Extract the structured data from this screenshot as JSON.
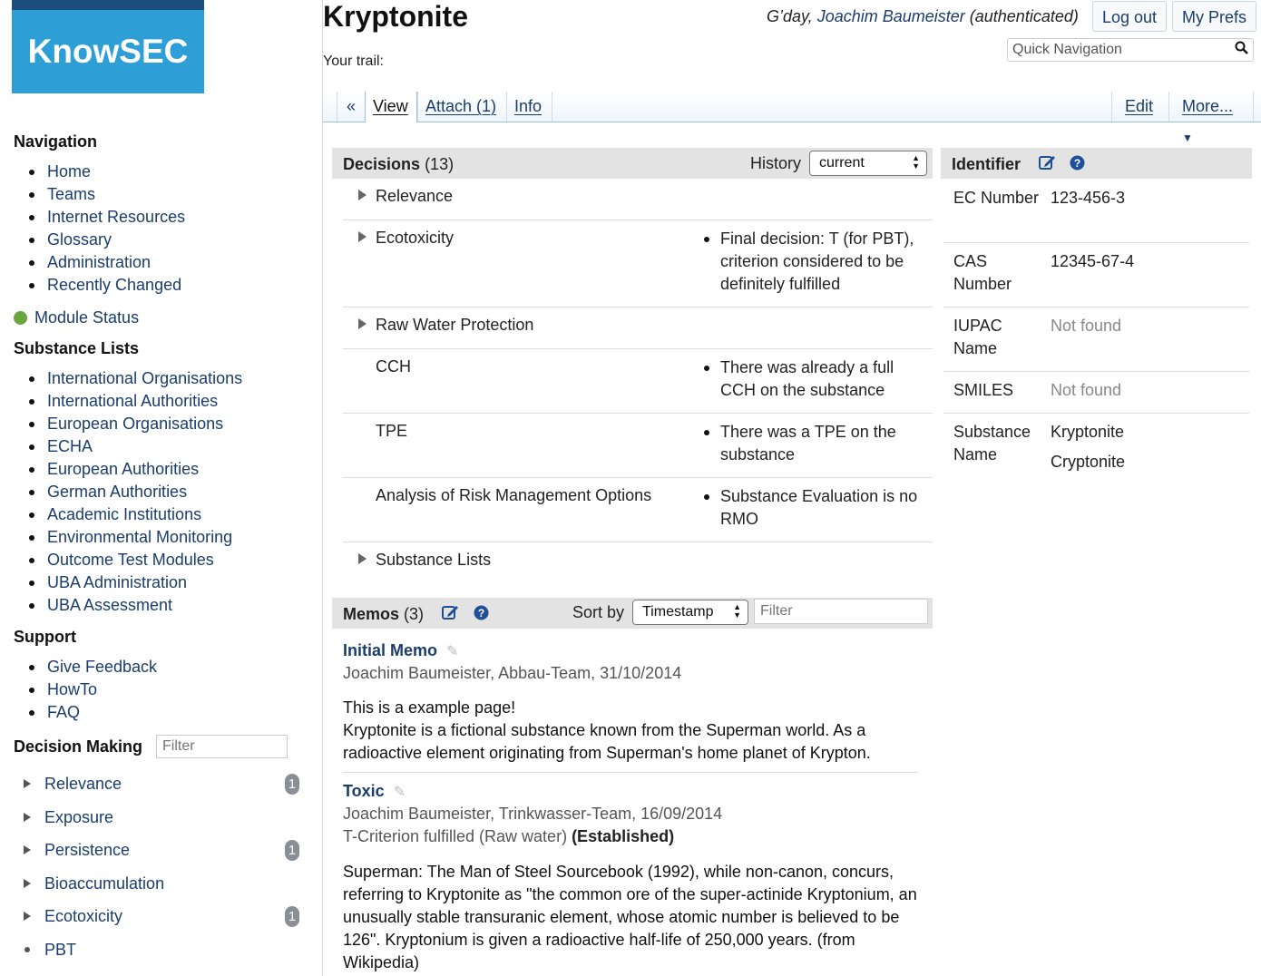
{
  "logo": {
    "text": "KnowSEC"
  },
  "page": {
    "title": "Kryptonite",
    "trail_label": "Your trail:"
  },
  "user": {
    "greeting_prefix": "G’day, ",
    "name": "Joachim Baumeister",
    "status": " (authenticated)"
  },
  "header_buttons": {
    "logout": "Log out",
    "prefs": "My Prefs"
  },
  "quick_nav": {
    "placeholder": "Quick Navigation"
  },
  "tabs": {
    "collapse": "«",
    "view": "View",
    "attach": "Attach (1)",
    "info": "Info",
    "edit": "Edit",
    "more": "More..."
  },
  "sidebar": {
    "navigation_title": "Navigation",
    "navigation": [
      "Home",
      "Teams",
      "Internet Resources",
      "Glossary",
      "Administration",
      "Recently Changed"
    ],
    "module_status": "Module Status",
    "substance_lists_title": "Substance Lists",
    "substance_lists": [
      "International Organisations",
      "International Authorities",
      "European Organisations",
      "ECHA",
      "European Authorities",
      "German Authorities",
      "Academic Institutions",
      "Environmental Monitoring",
      "Outcome Test Modules",
      "UBA Administration",
      "UBA Assessment"
    ],
    "support_title": "Support",
    "support": [
      "Give Feedback",
      "HowTo",
      "FAQ"
    ],
    "decision_making_title": "Decision Making",
    "filter_placeholder": "Filter",
    "decision_making": [
      {
        "label": "Relevance",
        "badge": "1"
      },
      {
        "label": "Exposure",
        "badge": ""
      },
      {
        "label": "Persistence",
        "badge": "1"
      },
      {
        "label": "Bioaccumulation",
        "badge": ""
      },
      {
        "label": "Ecotoxicity",
        "badge": "1"
      },
      {
        "label": "PBT",
        "badge": ""
      }
    ]
  },
  "decisions": {
    "title": "Decisions",
    "count": "(13)",
    "history_label": "History",
    "history_value": "current",
    "rows": [
      {
        "label": "Relevance",
        "note": ""
      },
      {
        "label": "Ecotoxicity",
        "note": "Final decision: T (for PBT), criterion considered to be definitely fulfilled"
      },
      {
        "label": "Raw Water Protection",
        "note": ""
      },
      {
        "label": "CCH",
        "note": "There was already a full CCH on the substance"
      },
      {
        "label": "TPE",
        "note": "There was a TPE on the substance"
      },
      {
        "label": "Analysis of Risk Management Options",
        "note": "Substance Evaluation is no RMO"
      },
      {
        "label": "Substance Lists",
        "note": ""
      }
    ]
  },
  "identifier": {
    "title": "Identifier",
    "rows": [
      {
        "key": "EC Number",
        "value": "123-456-3"
      },
      {
        "key": "CAS Number",
        "value": "12345-67-4"
      },
      {
        "key": "IUPAC Name",
        "value": "Not found"
      },
      {
        "key": "SMILES",
        "value": "Not found"
      },
      {
        "key": "Substance Name",
        "value": "Kryptonite",
        "value2": "Cryptonite"
      }
    ]
  },
  "memos": {
    "title": "Memos",
    "count": "(3)",
    "sort_label": "Sort by",
    "sort_value": "Timestamp",
    "filter_placeholder": "Filter",
    "items": [
      {
        "title": "Initial Memo",
        "meta": "Joachim Baumeister, Abbau-Team, 31/10/2014",
        "body1": "This is a example page!",
        "body2": "Kryptonite is a fictional substance known from the Superman world. As a radioactive element originating from Superman's home planet of Krypton."
      },
      {
        "title": "Toxic",
        "meta": "Joachim Baumeister, Trinkwasser-Team, 16/09/2014",
        "criterion": "T-Criterion fulfilled (Raw water) ",
        "criterion_status": "(Established)",
        "body1": "Superman: The Man of Steel Sourcebook (1992), while non-canon, concurs, referring to Kryptonite as \"the common ore of the super-actinide Kryptonium, an unusually stable transuranic element, whose atomic number is believed to be 126\". Kryptonium is given a radioactive half-life of 250,000 years. (from Wikipedia)"
      }
    ]
  },
  "colors": {
    "link": "#1a3d6e",
    "logo_bg": "#2e9fd6",
    "status_ok": "#6aa63d"
  }
}
